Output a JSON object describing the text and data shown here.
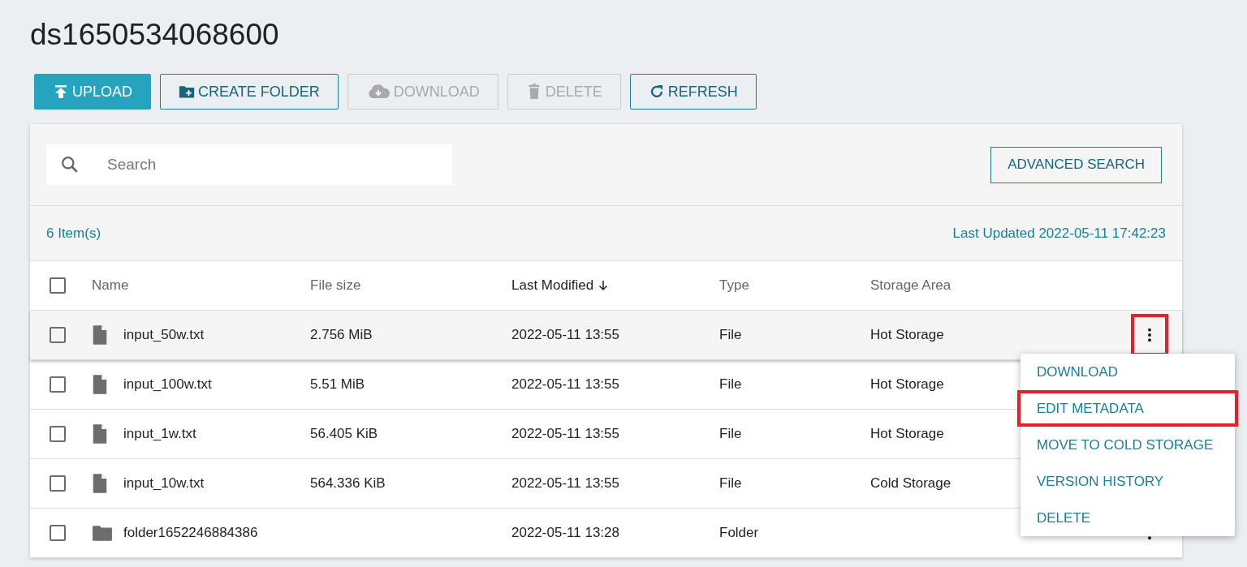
{
  "title": "ds1650534068600",
  "toolbar": [
    {
      "kind": "upload",
      "label": "UPLOAD",
      "disabled": false,
      "primary": true
    },
    {
      "kind": "create-folder",
      "label": "CREATE FOLDER",
      "disabled": false,
      "primary": false
    },
    {
      "kind": "download",
      "label": "DOWNLOAD",
      "disabled": true,
      "primary": false
    },
    {
      "kind": "delete",
      "label": "DELETE",
      "disabled": true,
      "primary": false
    },
    {
      "kind": "refresh",
      "label": "REFRESH",
      "disabled": false,
      "primary": false
    }
  ],
  "search": {
    "placeholder": "Search"
  },
  "advanced_search": "ADVANCED SEARCH",
  "item_count": "6 Item(s)",
  "last_updated": "Last Updated 2022-05-11 17:42:23",
  "select_all_checked": false,
  "more_button_highlighted": true,
  "columns": [
    {
      "label": "Name",
      "sorted": false
    },
    {
      "label": "File size",
      "sorted": false
    },
    {
      "label": "Last Modified",
      "sorted": true
    },
    {
      "label": "Type",
      "sorted": false
    },
    {
      "label": "Storage Area",
      "sorted": false
    }
  ],
  "rows": [
    {
      "kind": "file",
      "name": "input_50w.txt",
      "size": "2.756 MiB",
      "modified": "2022-05-11 13:55",
      "type": "File",
      "storage": "Hot Storage",
      "checked": false,
      "hovered": true
    },
    {
      "kind": "file",
      "name": "input_100w.txt",
      "size": "5.51 MiB",
      "modified": "2022-05-11 13:55",
      "type": "File",
      "storage": "Hot Storage",
      "checked": false,
      "hovered": false
    },
    {
      "kind": "file",
      "name": "input_1w.txt",
      "size": "56.405 KiB",
      "modified": "2022-05-11 13:55",
      "type": "File",
      "storage": "Hot Storage",
      "checked": false,
      "hovered": false
    },
    {
      "kind": "file",
      "name": "input_10w.txt",
      "size": "564.336 KiB",
      "modified": "2022-05-11 13:55",
      "type": "File",
      "storage": "Cold Storage",
      "checked": false,
      "hovered": false
    },
    {
      "kind": "folder",
      "name": "folder1652246884386",
      "size": "",
      "modified": "2022-05-11 13:28",
      "type": "Folder",
      "storage": "",
      "checked": false,
      "hovered": false
    }
  ],
  "menu": [
    {
      "label": "DOWNLOAD",
      "highlighted": false
    },
    {
      "label": "EDIT METADATA",
      "highlighted": true
    },
    {
      "label": "MOVE TO COLD STORAGE",
      "highlighted": false
    },
    {
      "label": "VERSION HISTORY",
      "highlighted": false
    },
    {
      "label": "DELETE",
      "highlighted": false
    }
  ]
}
